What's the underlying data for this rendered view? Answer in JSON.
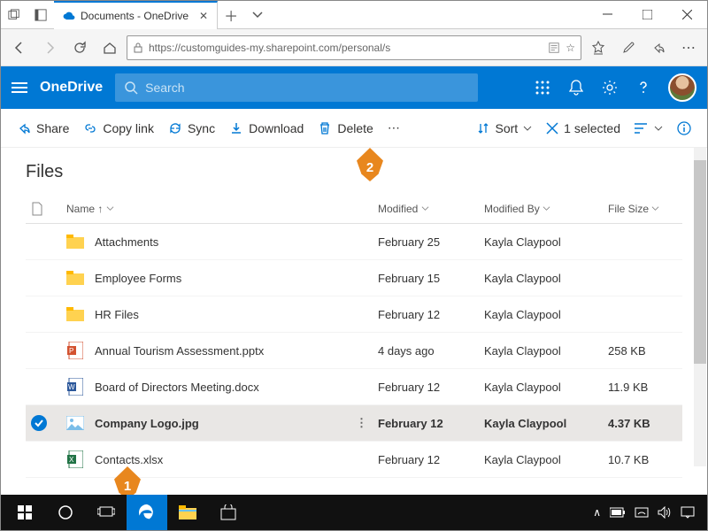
{
  "window": {
    "tab_title": "Documents - OneDrive"
  },
  "addressbar": {
    "url": "https://customguides-my.sharepoint.com/personal/s"
  },
  "onedrive": {
    "brand": "OneDrive",
    "search_placeholder": "Search"
  },
  "toolbar": {
    "share": "Share",
    "copylink": "Copy link",
    "sync": "Sync",
    "download": "Download",
    "delete": "Delete",
    "sort": "Sort",
    "selected": "1 selected"
  },
  "page": {
    "title": "Files"
  },
  "columns": {
    "name": "Name",
    "modified": "Modified",
    "modified_by": "Modified By",
    "size": "File Size"
  },
  "rows": [
    {
      "icon": "folder",
      "name": "Attachments",
      "modified": "February 25",
      "by": "Kayla Claypool",
      "size": ""
    },
    {
      "icon": "folder",
      "name": "Employee Forms",
      "modified": "February 15",
      "by": "Kayla Claypool",
      "size": ""
    },
    {
      "icon": "folder",
      "name": "HR Files",
      "modified": "February 12",
      "by": "Kayla Claypool",
      "size": ""
    },
    {
      "icon": "pptx",
      "name": "Annual Tourism Assessment.pptx",
      "modified": "4 days ago",
      "by": "Kayla Claypool",
      "size": "258 KB"
    },
    {
      "icon": "docx",
      "name": "Board of Directors Meeting.docx",
      "modified": "February 12",
      "by": "Kayla Claypool",
      "size": "11.9 KB"
    },
    {
      "icon": "jpg",
      "name": "Company Logo.jpg",
      "modified": "February 12",
      "by": "Kayla Claypool",
      "size": "4.37 KB",
      "selected": true
    },
    {
      "icon": "xlsx",
      "name": "Contacts.xlsx",
      "modified": "February 12",
      "by": "Kayla Claypool",
      "size": "10.7 KB"
    }
  ],
  "callouts": {
    "1": "1",
    "2": "2"
  }
}
